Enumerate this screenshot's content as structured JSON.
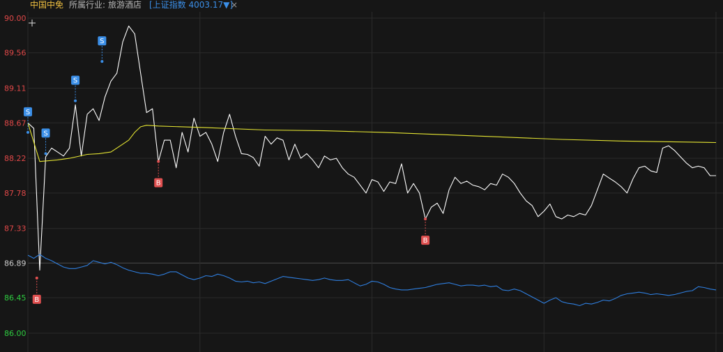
{
  "header": {
    "stock_name": "中国中免",
    "industry_label": "所属行业:",
    "industry_value": "旅游酒店",
    "index_link": "[上证指数 4003.17▼]",
    "close_symbol": "×"
  },
  "colors": {
    "background": "#161616",
    "grid": "#2b2b2b",
    "price_line": "#ffffff",
    "avg_line": "#e6e632",
    "index_line": "#2f7fe0",
    "axis_up": "#e04848",
    "axis_flat": "#cccccc",
    "axis_down": "#2ecc40",
    "sell_marker": "#3b8fe8",
    "buy_marker": "#e05050"
  },
  "chart_data": {
    "type": "line",
    "y_ticks": [
      "90.00",
      "89.56",
      "89.11",
      "88.67",
      "88.22",
      "87.78",
      "87.33",
      "86.89",
      "86.45",
      "86.00"
    ],
    "ylim": [
      86.0,
      90.0
    ],
    "series": [
      {
        "role": "price",
        "points": [
          [
            0,
            88.67
          ],
          [
            2,
            88.6
          ],
          [
            4,
            86.8
          ],
          [
            6,
            88.24
          ],
          [
            8,
            88.35
          ],
          [
            10,
            88.3
          ],
          [
            12,
            88.25
          ],
          [
            14,
            88.35
          ],
          [
            16,
            88.9
          ],
          [
            18,
            88.25
          ],
          [
            20,
            88.78
          ],
          [
            22,
            88.85
          ],
          [
            24,
            88.7
          ],
          [
            26,
            89.0
          ],
          [
            28,
            89.2
          ],
          [
            30,
            89.3
          ],
          [
            32,
            89.7
          ],
          [
            34,
            89.9
          ],
          [
            36,
            89.8
          ],
          [
            38,
            89.3
          ],
          [
            40,
            88.8
          ],
          [
            42,
            88.85
          ],
          [
            44,
            88.18
          ],
          [
            46,
            88.45
          ],
          [
            48,
            88.45
          ],
          [
            50,
            88.1
          ],
          [
            52,
            88.55
          ],
          [
            54,
            88.3
          ],
          [
            56,
            88.73
          ],
          [
            58,
            88.5
          ],
          [
            60,
            88.55
          ],
          [
            62,
            88.4
          ],
          [
            64,
            88.18
          ],
          [
            66,
            88.55
          ],
          [
            68,
            88.78
          ],
          [
            70,
            88.5
          ],
          [
            72,
            88.28
          ],
          [
            74,
            88.27
          ],
          [
            76,
            88.23
          ],
          [
            78,
            88.12
          ],
          [
            80,
            88.5
          ],
          [
            82,
            88.4
          ],
          [
            84,
            88.48
          ],
          [
            86,
            88.45
          ],
          [
            88,
            88.2
          ],
          [
            90,
            88.4
          ],
          [
            92,
            88.22
          ],
          [
            94,
            88.28
          ],
          [
            96,
            88.2
          ],
          [
            98,
            88.1
          ],
          [
            100,
            88.25
          ],
          [
            102,
            88.2
          ],
          [
            104,
            88.22
          ],
          [
            106,
            88.1
          ],
          [
            108,
            88.02
          ],
          [
            110,
            87.98
          ],
          [
            112,
            87.88
          ],
          [
            114,
            87.78
          ],
          [
            116,
            87.95
          ],
          [
            118,
            87.92
          ],
          [
            120,
            87.8
          ],
          [
            122,
            87.92
          ],
          [
            124,
            87.9
          ],
          [
            126,
            88.15
          ],
          [
            128,
            87.78
          ],
          [
            130,
            87.9
          ],
          [
            132,
            87.78
          ],
          [
            134,
            87.45
          ],
          [
            136,
            87.6
          ],
          [
            138,
            87.65
          ],
          [
            140,
            87.52
          ],
          [
            142,
            87.82
          ],
          [
            144,
            87.98
          ],
          [
            146,
            87.9
          ],
          [
            148,
            87.93
          ],
          [
            150,
            87.88
          ],
          [
            152,
            87.86
          ],
          [
            154,
            87.82
          ],
          [
            156,
            87.9
          ],
          [
            158,
            87.88
          ],
          [
            160,
            88.02
          ],
          [
            162,
            87.98
          ],
          [
            164,
            87.9
          ],
          [
            166,
            87.78
          ],
          [
            168,
            87.68
          ],
          [
            170,
            87.62
          ],
          [
            172,
            87.48
          ],
          [
            174,
            87.55
          ],
          [
            176,
            87.64
          ],
          [
            178,
            87.48
          ],
          [
            180,
            87.45
          ],
          [
            182,
            87.5
          ],
          [
            184,
            87.48
          ],
          [
            186,
            87.52
          ],
          [
            188,
            87.5
          ],
          [
            190,
            87.62
          ],
          [
            192,
            87.82
          ],
          [
            194,
            88.02
          ],
          [
            196,
            87.97
          ],
          [
            198,
            87.92
          ],
          [
            200,
            87.86
          ],
          [
            202,
            87.78
          ],
          [
            204,
            87.96
          ],
          [
            206,
            88.1
          ],
          [
            208,
            88.12
          ],
          [
            210,
            88.06
          ],
          [
            212,
            88.04
          ],
          [
            214,
            88.35
          ],
          [
            216,
            88.38
          ],
          [
            218,
            88.32
          ],
          [
            220,
            88.24
          ],
          [
            222,
            88.16
          ],
          [
            224,
            88.1
          ],
          [
            226,
            88.12
          ],
          [
            228,
            88.1
          ],
          [
            230,
            88.0
          ],
          [
            232,
            88.0
          ]
        ]
      },
      {
        "role": "average",
        "points": [
          [
            0,
            88.67
          ],
          [
            4,
            88.18
          ],
          [
            10,
            88.2
          ],
          [
            14,
            88.22
          ],
          [
            20,
            88.27
          ],
          [
            24,
            88.28
          ],
          [
            28,
            88.3
          ],
          [
            32,
            88.4
          ],
          [
            34,
            88.45
          ],
          [
            36,
            88.55
          ],
          [
            38,
            88.62
          ],
          [
            40,
            88.64
          ],
          [
            44,
            88.63
          ],
          [
            60,
            88.61
          ],
          [
            80,
            88.58
          ],
          [
            100,
            88.57
          ],
          [
            120,
            88.55
          ],
          [
            140,
            88.52
          ],
          [
            160,
            88.49
          ],
          [
            180,
            88.46
          ],
          [
            200,
            88.44
          ],
          [
            232,
            88.42
          ]
        ]
      },
      {
        "role": "index",
        "points": [
          [
            0,
            86.99
          ],
          [
            2,
            86.95
          ],
          [
            4,
            87.0
          ],
          [
            6,
            86.95
          ],
          [
            8,
            86.92
          ],
          [
            10,
            86.88
          ],
          [
            12,
            86.84
          ],
          [
            14,
            86.82
          ],
          [
            16,
            86.82
          ],
          [
            18,
            86.84
          ],
          [
            20,
            86.86
          ],
          [
            22,
            86.92
          ],
          [
            24,
            86.9
          ],
          [
            26,
            86.88
          ],
          [
            28,
            86.9
          ],
          [
            30,
            86.87
          ],
          [
            32,
            86.83
          ],
          [
            34,
            86.8
          ],
          [
            36,
            86.78
          ],
          [
            38,
            86.76
          ],
          [
            40,
            86.76
          ],
          [
            42,
            86.75
          ],
          [
            44,
            86.73
          ],
          [
            46,
            86.75
          ],
          [
            48,
            86.78
          ],
          [
            50,
            86.78
          ],
          [
            52,
            86.74
          ],
          [
            54,
            86.7
          ],
          [
            56,
            86.68
          ],
          [
            58,
            86.7
          ],
          [
            60,
            86.73
          ],
          [
            62,
            86.72
          ],
          [
            64,
            86.75
          ],
          [
            66,
            86.73
          ],
          [
            68,
            86.7
          ],
          [
            70,
            86.66
          ],
          [
            72,
            86.65
          ],
          [
            74,
            86.66
          ],
          [
            76,
            86.64
          ],
          [
            78,
            86.65
          ],
          [
            80,
            86.63
          ],
          [
            82,
            86.66
          ],
          [
            84,
            86.69
          ],
          [
            86,
            86.72
          ],
          [
            88,
            86.71
          ],
          [
            90,
            86.7
          ],
          [
            92,
            86.69
          ],
          [
            94,
            86.68
          ],
          [
            96,
            86.67
          ],
          [
            98,
            86.68
          ],
          [
            100,
            86.7
          ],
          [
            102,
            86.68
          ],
          [
            104,
            86.67
          ],
          [
            106,
            86.67
          ],
          [
            108,
            86.68
          ],
          [
            110,
            86.64
          ],
          [
            112,
            86.6
          ],
          [
            114,
            86.62
          ],
          [
            116,
            86.66
          ],
          [
            118,
            86.65
          ],
          [
            120,
            86.62
          ],
          [
            122,
            86.58
          ],
          [
            124,
            86.56
          ],
          [
            126,
            86.55
          ],
          [
            128,
            86.55
          ],
          [
            130,
            86.56
          ],
          [
            132,
            86.57
          ],
          [
            134,
            86.58
          ],
          [
            136,
            86.6
          ],
          [
            138,
            86.62
          ],
          [
            140,
            86.63
          ],
          [
            142,
            86.64
          ],
          [
            144,
            86.62
          ],
          [
            146,
            86.6
          ],
          [
            148,
            86.61
          ],
          [
            150,
            86.61
          ],
          [
            152,
            86.6
          ],
          [
            154,
            86.61
          ],
          [
            156,
            86.59
          ],
          [
            158,
            86.6
          ],
          [
            160,
            86.55
          ],
          [
            162,
            86.54
          ],
          [
            164,
            86.56
          ],
          [
            166,
            86.54
          ],
          [
            168,
            86.5
          ],
          [
            170,
            86.46
          ],
          [
            172,
            86.42
          ],
          [
            174,
            86.38
          ],
          [
            176,
            86.42
          ],
          [
            178,
            86.45
          ],
          [
            180,
            86.4
          ],
          [
            182,
            86.38
          ],
          [
            184,
            86.37
          ],
          [
            186,
            86.35
          ],
          [
            188,
            86.38
          ],
          [
            190,
            86.37
          ],
          [
            192,
            86.39
          ],
          [
            194,
            86.42
          ],
          [
            196,
            86.41
          ],
          [
            198,
            86.44
          ],
          [
            200,
            86.48
          ],
          [
            202,
            86.5
          ],
          [
            204,
            86.51
          ],
          [
            206,
            86.52
          ],
          [
            208,
            86.51
          ],
          [
            210,
            86.49
          ],
          [
            212,
            86.5
          ],
          [
            214,
            86.49
          ],
          [
            216,
            86.48
          ],
          [
            218,
            86.49
          ],
          [
            220,
            86.51
          ],
          [
            222,
            86.53
          ],
          [
            224,
            86.54
          ],
          [
            226,
            86.59
          ],
          [
            228,
            86.58
          ],
          [
            230,
            86.56
          ],
          [
            232,
            86.55
          ]
        ]
      }
    ],
    "markers": [
      {
        "type": "S",
        "t": 0,
        "price": 88.55
      },
      {
        "type": "S",
        "t": 6,
        "price": 88.28
      },
      {
        "type": "S",
        "t": 16,
        "price": 88.95
      },
      {
        "type": "S",
        "t": 25,
        "price": 89.45
      },
      {
        "type": "B",
        "t": 3,
        "price": 86.7
      },
      {
        "type": "B",
        "t": 44,
        "price": 88.18
      },
      {
        "type": "B",
        "t": 134,
        "price": 87.45
      }
    ]
  }
}
